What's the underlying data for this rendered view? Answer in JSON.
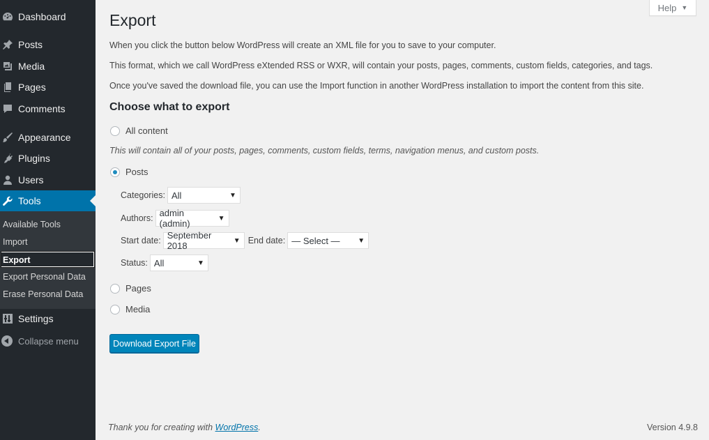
{
  "sidebar": {
    "items": [
      {
        "key": "dashboard",
        "label": "Dashboard",
        "icon": "dashboard-icon"
      },
      {
        "key": "posts",
        "label": "Posts",
        "icon": "pin-icon"
      },
      {
        "key": "media",
        "label": "Media",
        "icon": "media-icon"
      },
      {
        "key": "pages",
        "label": "Pages",
        "icon": "pages-icon"
      },
      {
        "key": "comments",
        "label": "Comments",
        "icon": "comment-icon"
      },
      {
        "key": "appearance",
        "label": "Appearance",
        "icon": "brush-icon"
      },
      {
        "key": "plugins",
        "label": "Plugins",
        "icon": "plugin-icon"
      },
      {
        "key": "users",
        "label": "Users",
        "icon": "user-icon"
      },
      {
        "key": "tools",
        "label": "Tools",
        "icon": "wrench-icon"
      },
      {
        "key": "settings",
        "label": "Settings",
        "icon": "settings-icon"
      }
    ],
    "submenu": [
      "Available Tools",
      "Import",
      "Export",
      "Export Personal Data",
      "Erase Personal Data"
    ],
    "collapse_label": "Collapse menu"
  },
  "header": {
    "help_label": "Help",
    "title": "Export"
  },
  "content": {
    "p1": "When you click the button below WordPress will create an XML file for you to save to your computer.",
    "p2": "This format, which we call WordPress eXtended RSS or WXR, will contain your posts, pages, comments, custom fields, categories, and tags.",
    "p3": "Once you've saved the download file, you can use the Import function in another WordPress installation to import the content from this site.",
    "section_title": "Choose what to export",
    "all_content_label": "All content",
    "all_content_desc": "This will contain all of your posts, pages, comments, custom fields, terms, navigation menus, and custom posts.",
    "posts_label": "Posts",
    "categories_label": "Categories:",
    "categories_value": "All",
    "authors_label": "Authors:",
    "authors_value": "admin (admin)",
    "start_date_label": "Start date:",
    "start_date_value": "September 2018",
    "end_date_label": "End date:",
    "end_date_value": "— Select —",
    "status_label": "Status:",
    "status_value": "All",
    "pages_label": "Pages",
    "media_label": "Media",
    "download_button": "Download Export File"
  },
  "footer": {
    "thanks_prefix": "Thank you for creating with ",
    "thanks_link": "WordPress",
    "thanks_suffix": ".",
    "version": "Version 4.9.8"
  },
  "colors": {
    "sidebar_bg": "#23282d",
    "submenu_bg": "#32373c",
    "accent": "#0073aa",
    "primary_button": "#0085ba",
    "page_bg": "#f1f1f1"
  }
}
